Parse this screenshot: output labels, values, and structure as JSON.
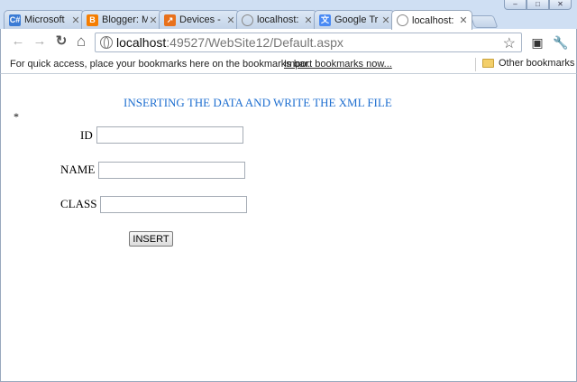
{
  "window": {
    "controls": [
      "–",
      "□",
      "✕"
    ]
  },
  "tabs": [
    {
      "label": "Microsoft",
      "favicon": "C#",
      "favicon_color": "#3a7bd5",
      "active": false
    },
    {
      "label": "Blogger: M",
      "favicon": "B",
      "favicon_color": "#f57d00",
      "active": false
    },
    {
      "label": "Devices - ",
      "favicon": "↗",
      "favicon_color": "#e8711c",
      "active": false
    },
    {
      "label": "localhost:",
      "favicon": "globe",
      "favicon_color": "#888888",
      "active": false
    },
    {
      "label": "Google Tr",
      "favicon": "文",
      "favicon_color": "#4a8af4",
      "active": false
    },
    {
      "label": "localhost:",
      "favicon": "globe",
      "favicon_color": "#888888",
      "active": true
    }
  ],
  "toolbar": {
    "back_icon": "←",
    "forward_icon": "→",
    "reload_icon": "↻",
    "home_icon": "⌂",
    "url_host": "localhost",
    "url_path": ":49527/WebSite12/Default.aspx",
    "star_icon": "☆",
    "ext_icon": "▣",
    "wrench_icon": "🔧"
  },
  "bookmarks": {
    "prompt": "For quick access, place your bookmarks here on the bookmarks bar.",
    "import_link": "Import bookmarks now...",
    "other": "Other bookmarks"
  },
  "page": {
    "heading": "INSERTING THE DATA AND WRITE THE XML FILE",
    "asterisk": "*",
    "fields": {
      "id_label": "ID",
      "id_value": "",
      "name_label": "NAME",
      "name_value": "",
      "class_label": "CLASS",
      "class_value": ""
    },
    "insert_label": "INSERT"
  },
  "colors": {
    "heading": "#1f6fd0",
    "frame": "#cfdff3"
  }
}
